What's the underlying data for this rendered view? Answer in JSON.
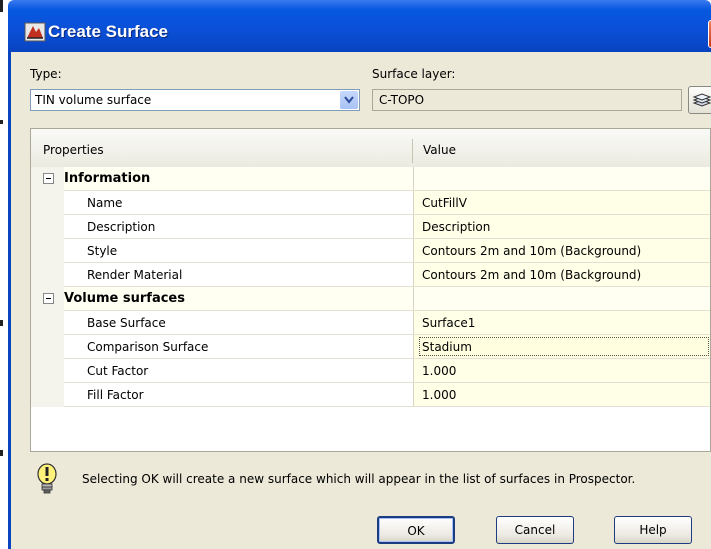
{
  "dialog": {
    "title": "Create Surface"
  },
  "type_field": {
    "label": "Type:",
    "value": "TIN volume surface"
  },
  "layer_field": {
    "label": "Surface layer:",
    "value": "C-TOPO"
  },
  "grid": {
    "headers": {
      "properties": "Properties",
      "value": "Value"
    },
    "categories": [
      {
        "label": "Information",
        "rows": [
          {
            "name": "Name",
            "value": "CutFillV"
          },
          {
            "name": "Description",
            "value": "Description"
          },
          {
            "name": "Style",
            "value": "Contours 2m and 10m (Background)"
          },
          {
            "name": "Render Material",
            "value": "Contours 2m and 10m (Background)"
          }
        ]
      },
      {
        "label": "Volume surfaces",
        "rows": [
          {
            "name": "Base Surface",
            "value": "Surface1"
          },
          {
            "name": "Comparison Surface",
            "value": "Stadium"
          },
          {
            "name": "Cut Factor",
            "value": "1.000"
          },
          {
            "name": "Fill Factor",
            "value": "1.000"
          }
        ]
      }
    ]
  },
  "info_message": "Selecting OK will create a new surface which will appear in the list of surfaces in Prospector.",
  "buttons": {
    "ok": "OK",
    "cancel": "Cancel",
    "help": "Help"
  },
  "colors": {
    "titlebar": "#0a4fd6",
    "dialog_bg": "#ece9d8",
    "value_cell_bg": "#ffffe7"
  }
}
